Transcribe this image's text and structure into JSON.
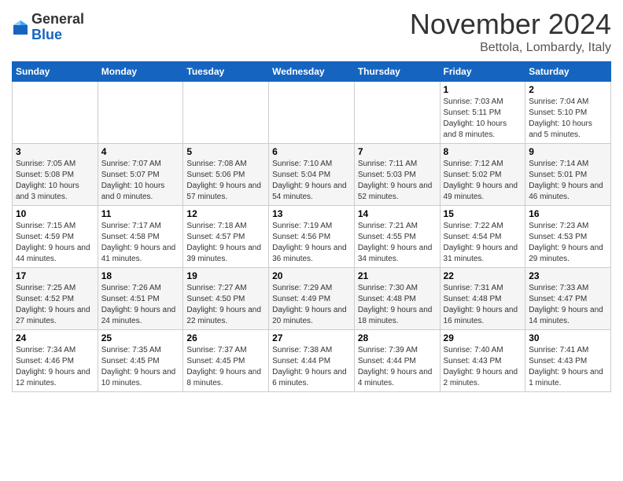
{
  "header": {
    "logo_general": "General",
    "logo_blue": "Blue",
    "month_title": "November 2024",
    "location": "Bettola, Lombardy, Italy"
  },
  "weekdays": [
    "Sunday",
    "Monday",
    "Tuesday",
    "Wednesday",
    "Thursday",
    "Friday",
    "Saturday"
  ],
  "weeks": [
    [
      {
        "day": "",
        "info": ""
      },
      {
        "day": "",
        "info": ""
      },
      {
        "day": "",
        "info": ""
      },
      {
        "day": "",
        "info": ""
      },
      {
        "day": "",
        "info": ""
      },
      {
        "day": "1",
        "info": "Sunrise: 7:03 AM\nSunset: 5:11 PM\nDaylight: 10 hours\nand 8 minutes."
      },
      {
        "day": "2",
        "info": "Sunrise: 7:04 AM\nSunset: 5:10 PM\nDaylight: 10 hours\nand 5 minutes."
      }
    ],
    [
      {
        "day": "3",
        "info": "Sunrise: 7:05 AM\nSunset: 5:08 PM\nDaylight: 10 hours\nand 3 minutes."
      },
      {
        "day": "4",
        "info": "Sunrise: 7:07 AM\nSunset: 5:07 PM\nDaylight: 10 hours\nand 0 minutes."
      },
      {
        "day": "5",
        "info": "Sunrise: 7:08 AM\nSunset: 5:06 PM\nDaylight: 9 hours\nand 57 minutes."
      },
      {
        "day": "6",
        "info": "Sunrise: 7:10 AM\nSunset: 5:04 PM\nDaylight: 9 hours\nand 54 minutes."
      },
      {
        "day": "7",
        "info": "Sunrise: 7:11 AM\nSunset: 5:03 PM\nDaylight: 9 hours\nand 52 minutes."
      },
      {
        "day": "8",
        "info": "Sunrise: 7:12 AM\nSunset: 5:02 PM\nDaylight: 9 hours\nand 49 minutes."
      },
      {
        "day": "9",
        "info": "Sunrise: 7:14 AM\nSunset: 5:01 PM\nDaylight: 9 hours\nand 46 minutes."
      }
    ],
    [
      {
        "day": "10",
        "info": "Sunrise: 7:15 AM\nSunset: 4:59 PM\nDaylight: 9 hours\nand 44 minutes."
      },
      {
        "day": "11",
        "info": "Sunrise: 7:17 AM\nSunset: 4:58 PM\nDaylight: 9 hours\nand 41 minutes."
      },
      {
        "day": "12",
        "info": "Sunrise: 7:18 AM\nSunset: 4:57 PM\nDaylight: 9 hours\nand 39 minutes."
      },
      {
        "day": "13",
        "info": "Sunrise: 7:19 AM\nSunset: 4:56 PM\nDaylight: 9 hours\nand 36 minutes."
      },
      {
        "day": "14",
        "info": "Sunrise: 7:21 AM\nSunset: 4:55 PM\nDaylight: 9 hours\nand 34 minutes."
      },
      {
        "day": "15",
        "info": "Sunrise: 7:22 AM\nSunset: 4:54 PM\nDaylight: 9 hours\nand 31 minutes."
      },
      {
        "day": "16",
        "info": "Sunrise: 7:23 AM\nSunset: 4:53 PM\nDaylight: 9 hours\nand 29 minutes."
      }
    ],
    [
      {
        "day": "17",
        "info": "Sunrise: 7:25 AM\nSunset: 4:52 PM\nDaylight: 9 hours\nand 27 minutes."
      },
      {
        "day": "18",
        "info": "Sunrise: 7:26 AM\nSunset: 4:51 PM\nDaylight: 9 hours\nand 24 minutes."
      },
      {
        "day": "19",
        "info": "Sunrise: 7:27 AM\nSunset: 4:50 PM\nDaylight: 9 hours\nand 22 minutes."
      },
      {
        "day": "20",
        "info": "Sunrise: 7:29 AM\nSunset: 4:49 PM\nDaylight: 9 hours\nand 20 minutes."
      },
      {
        "day": "21",
        "info": "Sunrise: 7:30 AM\nSunset: 4:48 PM\nDaylight: 9 hours\nand 18 minutes."
      },
      {
        "day": "22",
        "info": "Sunrise: 7:31 AM\nSunset: 4:48 PM\nDaylight: 9 hours\nand 16 minutes."
      },
      {
        "day": "23",
        "info": "Sunrise: 7:33 AM\nSunset: 4:47 PM\nDaylight: 9 hours\nand 14 minutes."
      }
    ],
    [
      {
        "day": "24",
        "info": "Sunrise: 7:34 AM\nSunset: 4:46 PM\nDaylight: 9 hours\nand 12 minutes."
      },
      {
        "day": "25",
        "info": "Sunrise: 7:35 AM\nSunset: 4:45 PM\nDaylight: 9 hours\nand 10 minutes."
      },
      {
        "day": "26",
        "info": "Sunrise: 7:37 AM\nSunset: 4:45 PM\nDaylight: 9 hours\nand 8 minutes."
      },
      {
        "day": "27",
        "info": "Sunrise: 7:38 AM\nSunset: 4:44 PM\nDaylight: 9 hours\nand 6 minutes."
      },
      {
        "day": "28",
        "info": "Sunrise: 7:39 AM\nSunset: 4:44 PM\nDaylight: 9 hours\nand 4 minutes."
      },
      {
        "day": "29",
        "info": "Sunrise: 7:40 AM\nSunset: 4:43 PM\nDaylight: 9 hours\nand 2 minutes."
      },
      {
        "day": "30",
        "info": "Sunrise: 7:41 AM\nSunset: 4:43 PM\nDaylight: 9 hours\nand 1 minute."
      }
    ]
  ]
}
